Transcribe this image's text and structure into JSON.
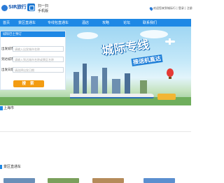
{
  "header": {
    "logo_text": "SIR旅行",
    "app_line1": "扫一扫",
    "app_line2": "手机版",
    "location_text": "欢迎您来到城际行 | 登录 | 注册"
  },
  "nav": {
    "items": [
      "首页",
      "景区直通车",
      "专线包直通车",
      "酒店",
      "攻略",
      "论坛",
      "联系我们"
    ]
  },
  "banner": {
    "slogan_main": "城际专线",
    "slogan_sub": "接送机直达"
  },
  "booking": {
    "title": "城际巴士预订",
    "rows": [
      {
        "label": "出发城市",
        "placeholder": "请输入出发城市名称"
      },
      {
        "label": "到达城市",
        "placeholder": "请输入到达城市名称或景区名称"
      },
      {
        "label": "出发日期",
        "placeholder": "请选择出发日期"
      }
    ],
    "search_label": "搜 索"
  },
  "city": {
    "name": "上海市"
  },
  "section": {
    "title": "景区直通车"
  },
  "colors": {
    "primary": "#1e88e5",
    "accent": "#f39c12"
  }
}
